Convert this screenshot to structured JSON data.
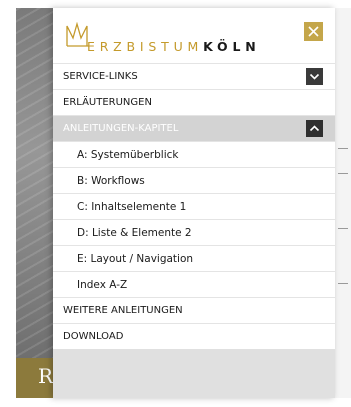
{
  "logo": {
    "text_light": "ERZBISTUM",
    "text_bold": "KÖLN",
    "icon": "crown-m-logo-icon",
    "accent_color": "#c49a2b"
  },
  "close": {
    "icon": "close-icon",
    "color": "#c4a64a"
  },
  "background": {
    "initial": "R"
  },
  "menu": {
    "items": [
      {
        "label": "SERVICE-LINKS",
        "level": "top",
        "toggle": "chevron-down-icon"
      },
      {
        "label": "ERLÄUTERUNGEN",
        "level": "top"
      },
      {
        "label": "ANLEITUNGEN-KAPITEL",
        "level": "top",
        "active": true,
        "toggle": "chevron-up-icon"
      },
      {
        "label": "A: Systemüberblick",
        "level": "sub"
      },
      {
        "label": "B: Workflows",
        "level": "sub"
      },
      {
        "label": "C: Inhaltselemente 1",
        "level": "sub"
      },
      {
        "label": "D: Liste & Elemente 2",
        "level": "sub"
      },
      {
        "label": "E: Layout / Navigation",
        "level": "sub"
      },
      {
        "label": "Index A-Z",
        "level": "sub"
      },
      {
        "label": "WEITERE ANLEITUNGEN",
        "level": "top"
      },
      {
        "label": "DOWNLOAD",
        "level": "top"
      }
    ]
  }
}
